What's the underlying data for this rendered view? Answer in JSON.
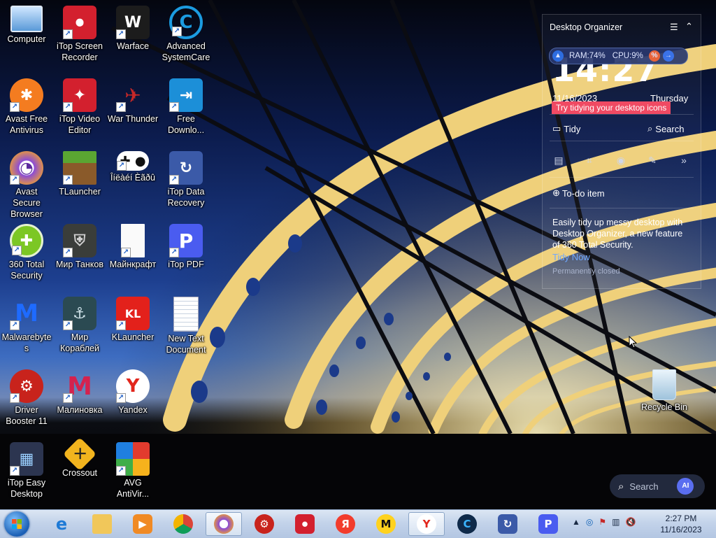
{
  "desktop": {
    "icons": [
      {
        "label": "Computer"
      },
      {
        "label": "iTop Screen Recorder"
      },
      {
        "label": "Warface"
      },
      {
        "label": "Advanced SystemCare"
      },
      {
        "label": "Avast Free Antivirus"
      },
      {
        "label": "iTop Video Editor"
      },
      {
        "label": "War Thunder"
      },
      {
        "label": "Free Downlo..."
      },
      {
        "label": "Avast Secure Browser"
      },
      {
        "label": "TLauncher"
      },
      {
        "label": "Îíëàéí Èãðû"
      },
      {
        "label": "iTop Data Recovery"
      },
      {
        "label": "360 Total Security"
      },
      {
        "label": "Мир Танков"
      },
      {
        "label": "Майнкрафт"
      },
      {
        "label": "iTop PDF"
      },
      {
        "label": "Malwarebytes"
      },
      {
        "label": "Мир Кораблей"
      },
      {
        "label": "KLauncher"
      },
      {
        "label": "New Text Document"
      },
      {
        "label": "Driver Booster 11"
      },
      {
        "label": "Малиновка"
      },
      {
        "label": "Yandex"
      },
      {
        "label": "iTop Easy Desktop"
      },
      {
        "label": "Crossout"
      },
      {
        "label": "AVG AntiVir..."
      }
    ],
    "recycle_bin": {
      "label": "Recycle Bin"
    }
  },
  "organizer": {
    "title": "Desktop Organizer",
    "menu_icon": "☰",
    "collapse_icon": "⌃",
    "clock": "14:27",
    "ram": "RAM:74%",
    "cpu": "CPU:9%",
    "date": "11/16/2023",
    "day": "Thursday",
    "tip": "Try tidying your desktop icons",
    "tidy": "Tidy",
    "search": "Search",
    "todo": "To-do item",
    "promo": "Easily tidy up messy desktop with Desktop Organizer, a new feature of 360 Total Security.",
    "tidy_now": "Tidy Now",
    "permanently_closed": "Permanently closed"
  },
  "search_widget": {
    "placeholder": "Search",
    "ai_label": "AI"
  },
  "taskbar": {
    "clock_time": "2:27 PM",
    "clock_date": "11/16/2023",
    "pinned": [
      {
        "name": "internet-explorer"
      },
      {
        "name": "file-explorer"
      },
      {
        "name": "media-player"
      },
      {
        "name": "chrome"
      },
      {
        "name": "avast-secure-browser"
      },
      {
        "name": "driver-booster"
      },
      {
        "name": "itop-screen-recorder"
      },
      {
        "name": "yandex-browser"
      },
      {
        "name": "yandex-market"
      },
      {
        "name": "yandex"
      },
      {
        "name": "advanced-systemcare"
      },
      {
        "name": "itop-data-recovery"
      },
      {
        "name": "itop-pdf"
      }
    ]
  },
  "colors": {
    "accent": "#f04a63",
    "link": "#6fa8ff",
    "pill": "#283770"
  }
}
